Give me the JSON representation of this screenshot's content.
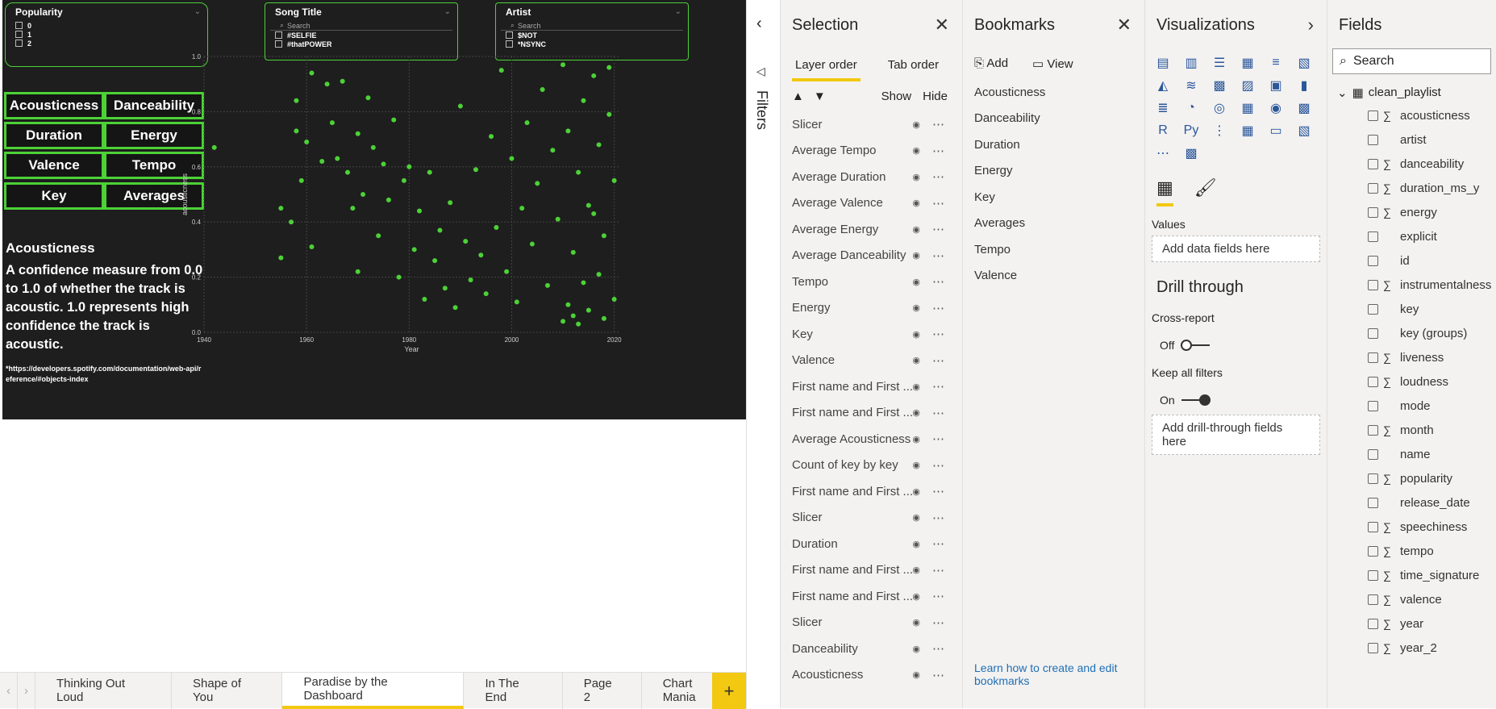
{
  "slicers": {
    "popularity": {
      "title": "Popularity",
      "options": [
        "0",
        "1",
        "2"
      ]
    },
    "song": {
      "title": "Song Title",
      "search": "Search",
      "options": [
        "#SELFIE",
        "#thatPOWER"
      ]
    },
    "artist": {
      "title": "Artist",
      "search": "Search",
      "options": [
        "$NOT",
        "*NSYNC"
      ]
    }
  },
  "buttons": [
    "Acousticness",
    "Danceability",
    "Duration",
    "Energy",
    "Valence",
    "Tempo",
    "Key",
    "Averages"
  ],
  "description": {
    "heading": "Acousticness",
    "body": "A confidence measure from 0.0 to 1.0 of whether the track is acoustic. 1.0 represents high confidence the track is acoustic.",
    "source": "*https://developers.spotify.com/documentation/web-api/reference/#objects-index"
  },
  "chart_data": {
    "type": "scatter",
    "xlabel": "Year",
    "ylabel": "acousticness",
    "xlim": [
      1940,
      2021
    ],
    "ylim": [
      0,
      1
    ],
    "xticks": [
      "1940",
      "1960",
      "1980",
      "2000",
      "2020"
    ],
    "yticks": [
      "0.0",
      "0.2",
      "0.4",
      "0.6",
      "0.8",
      "1.0"
    ],
    "color": "#4cd137",
    "points": [
      [
        1942,
        0.67
      ],
      [
        1955,
        0.27
      ],
      [
        1955,
        0.45
      ],
      [
        1957,
        0.4
      ],
      [
        1958,
        0.84
      ],
      [
        1958,
        0.73
      ],
      [
        1959,
        0.55
      ],
      [
        1960,
        0.69
      ],
      [
        1961,
        0.94
      ],
      [
        1961,
        0.31
      ],
      [
        1963,
        0.62
      ],
      [
        1964,
        0.9
      ],
      [
        1965,
        0.76
      ],
      [
        1966,
        0.63
      ],
      [
        1967,
        0.91
      ],
      [
        1968,
        0.58
      ],
      [
        1969,
        0.45
      ],
      [
        1970,
        0.72
      ],
      [
        1970,
        0.22
      ],
      [
        1971,
        0.5
      ],
      [
        1972,
        0.85
      ],
      [
        1973,
        0.67
      ],
      [
        1974,
        0.35
      ],
      [
        1975,
        0.61
      ],
      [
        1976,
        0.48
      ],
      [
        1977,
        0.77
      ],
      [
        1978,
        0.2
      ],
      [
        1979,
        0.55
      ],
      [
        1980,
        0.6
      ],
      [
        1981,
        0.3
      ],
      [
        1982,
        0.44
      ],
      [
        1983,
        0.12
      ],
      [
        1984,
        0.58
      ],
      [
        1985,
        0.26
      ],
      [
        1986,
        0.37
      ],
      [
        1987,
        0.16
      ],
      [
        1988,
        0.47
      ],
      [
        1989,
        0.09
      ],
      [
        1990,
        0.82
      ],
      [
        1991,
        0.33
      ],
      [
        1992,
        0.19
      ],
      [
        1993,
        0.59
      ],
      [
        1994,
        0.28
      ],
      [
        1995,
        0.14
      ],
      [
        1996,
        0.71
      ],
      [
        1997,
        0.38
      ],
      [
        1998,
        0.95
      ],
      [
        1999,
        0.22
      ],
      [
        2000,
        0.63
      ],
      [
        2001,
        0.11
      ],
      [
        2002,
        0.45
      ],
      [
        2003,
        0.76
      ],
      [
        2004,
        0.32
      ],
      [
        2005,
        0.54
      ],
      [
        2006,
        0.88
      ],
      [
        2007,
        0.17
      ],
      [
        2008,
        0.66
      ],
      [
        2009,
        0.41
      ],
      [
        2010,
        0.97
      ],
      [
        2011,
        0.73
      ],
      [
        2012,
        0.29
      ],
      [
        2013,
        0.58
      ],
      [
        2014,
        0.84
      ],
      [
        2015,
        0.46
      ],
      [
        2016,
        0.93
      ],
      [
        2017,
        0.68
      ],
      [
        2018,
        0.35
      ],
      [
        2019,
        0.79
      ],
      [
        2020,
        0.55
      ],
      [
        2020,
        0.12
      ],
      [
        2019,
        0.96
      ],
      [
        2018,
        0.05
      ],
      [
        2017,
        0.21
      ],
      [
        2016,
        0.43
      ],
      [
        2015,
        0.08
      ],
      [
        2014,
        0.18
      ],
      [
        2013,
        0.03
      ],
      [
        2012,
        0.06
      ],
      [
        2011,
        0.1
      ],
      [
        2010,
        0.04
      ]
    ]
  },
  "filters_label": "Filters",
  "selection": {
    "title": "Selection",
    "tabs": [
      "Layer order",
      "Tab order"
    ],
    "show": "Show",
    "hide": "Hide",
    "items": [
      "Slicer",
      "Average Tempo",
      "Average Duration",
      "Average Valence",
      "Average Energy",
      "Average Danceability",
      "Tempo",
      "Energy",
      "Key",
      "Valence",
      "First name and First ...",
      "First name and First ...",
      "Average Acousticness",
      "Count of key by key",
      "First name and First ...",
      "Slicer",
      "Duration",
      "First name and First ...",
      "First name and First ...",
      "Slicer",
      "Danceability",
      "Acousticness"
    ]
  },
  "bookmarks": {
    "title": "Bookmarks",
    "add": "Add",
    "view": "View",
    "items": [
      "Acousticness",
      "Danceability",
      "Duration",
      "Energy",
      "Key",
      "Averages",
      "Tempo",
      "Valence"
    ],
    "link": "Learn how to create and edit bookmarks"
  },
  "visualizations": {
    "title": "Visualizations",
    "values": "Values",
    "add_fields": "Add data fields here",
    "drill": "Drill through",
    "cross": "Cross-report",
    "off": "Off",
    "keep": "Keep all filters",
    "on": "On",
    "add_drill": "Add drill-through fields here"
  },
  "fields": {
    "title": "Fields",
    "search": "Search",
    "table": "clean_playlist",
    "items": [
      [
        "acousticness",
        true
      ],
      [
        "artist",
        false
      ],
      [
        "danceability",
        true
      ],
      [
        "duration_ms_y",
        true
      ],
      [
        "energy",
        true
      ],
      [
        "explicit",
        false
      ],
      [
        "id",
        false
      ],
      [
        "instrumentalness",
        true
      ],
      [
        "key",
        false
      ],
      [
        "key (groups)",
        false
      ],
      [
        "liveness",
        true
      ],
      [
        "loudness",
        true
      ],
      [
        "mode",
        false
      ],
      [
        "month",
        true
      ],
      [
        "name",
        false
      ],
      [
        "popularity",
        true
      ],
      [
        "release_date",
        false
      ],
      [
        "speechiness",
        true
      ],
      [
        "tempo",
        true
      ],
      [
        "time_signature",
        true
      ],
      [
        "valence",
        true
      ],
      [
        "year",
        true
      ],
      [
        "year_2",
        true
      ]
    ]
  },
  "pages": [
    "Thinking Out Loud",
    "Shape of You",
    "Paradise by the Dashboard",
    "In The End",
    "Page 2",
    "Chart Mania"
  ]
}
